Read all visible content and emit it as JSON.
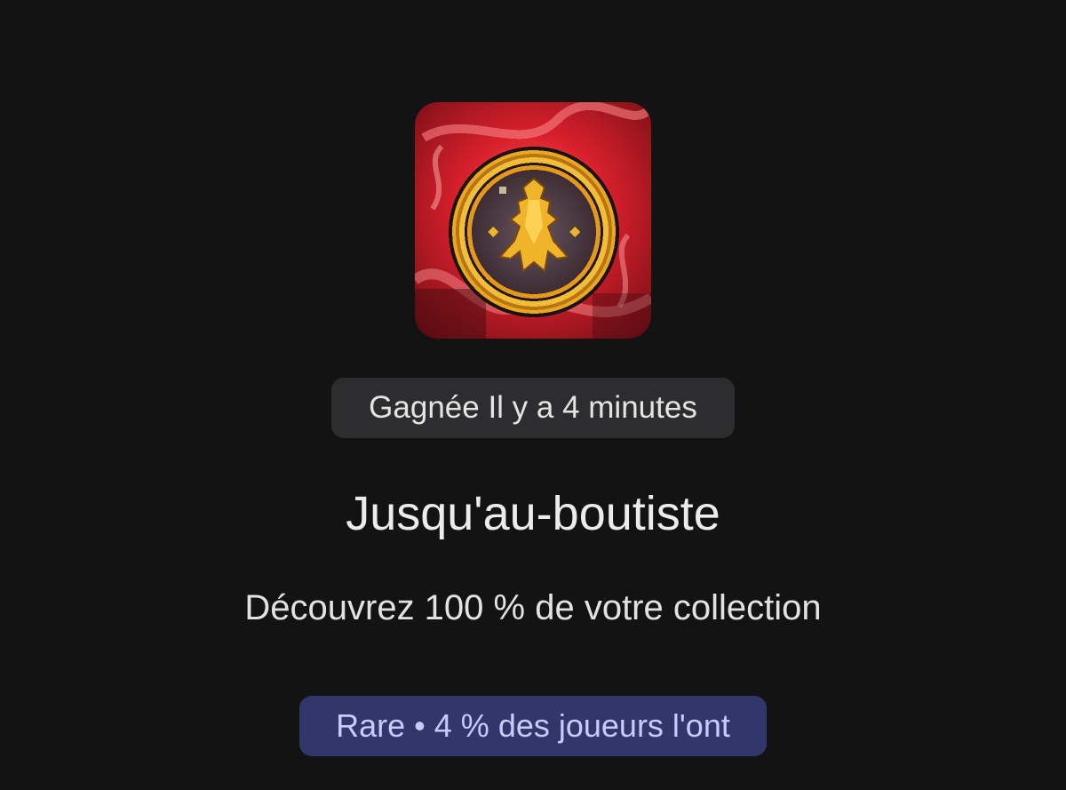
{
  "achievement": {
    "icon": "coin-emblem-icon",
    "earned_label": "Gagnée Il y a 4 minutes",
    "title": "Jusqu'au-boutiste",
    "description": "Découvrez 100 % de votre collection",
    "rarity_label": "Rare • 4 % des joueurs l'ont",
    "colors": {
      "background": "#131313",
      "earned_chip_bg": "#2d2d2f",
      "rarity_chip_bg": "#33366a",
      "rarity_text": "#c6ccff",
      "icon_backdrop": "#d8202c",
      "coin_gold": "#e8a821"
    }
  }
}
